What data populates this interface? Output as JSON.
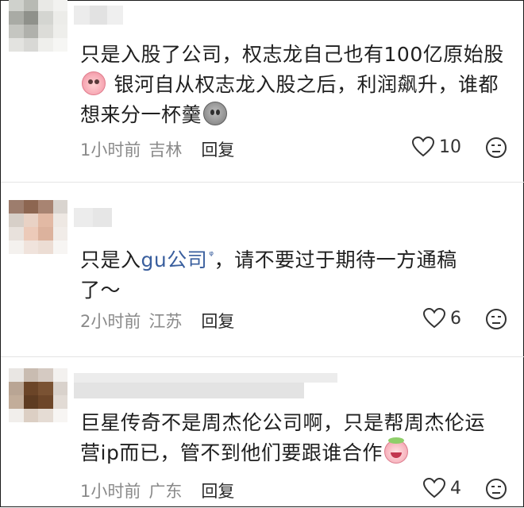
{
  "colors": {
    "text": "#1f1f1f",
    "meta": "#8a8a8a",
    "link": "#3a5f9e",
    "icon": "#333333"
  },
  "comments": [
    {
      "avatar_icon": "blurred-avatar",
      "text_line1": "只是入股了公司，权志龙自己也有100亿原始股",
      "emoji_1": "cry-emoji",
      "text_line2": "银河自从权志龙入股之后，利润飙升，谁都",
      "text_line3": "想来分一杯羹",
      "emoji_2": "ghost-emoji",
      "time": "1小时前",
      "location": "吉林",
      "reply_label": "回复",
      "likes": "10"
    },
    {
      "avatar_icon": "blurred-avatar",
      "text_pre": "只是入",
      "text_link": "gu公司",
      "text_post": "，请不要过于期待一方通稿",
      "text_line2": "了～",
      "search_glyph": "ᵠ",
      "time": "2小时前",
      "location": "江苏",
      "reply_label": "回复",
      "likes": "6"
    },
    {
      "avatar_icon": "blurred-avatar",
      "text_line1": "巨星传奇不是周杰伦公司啊，只是帮周杰伦运",
      "text_line2": "营ip而已，管不到他们要跟谁合作",
      "emoji_1": "laugh-cry-emoji",
      "time": "1小时前",
      "location": "广东",
      "reply_label": "回复",
      "likes": "4"
    }
  ]
}
